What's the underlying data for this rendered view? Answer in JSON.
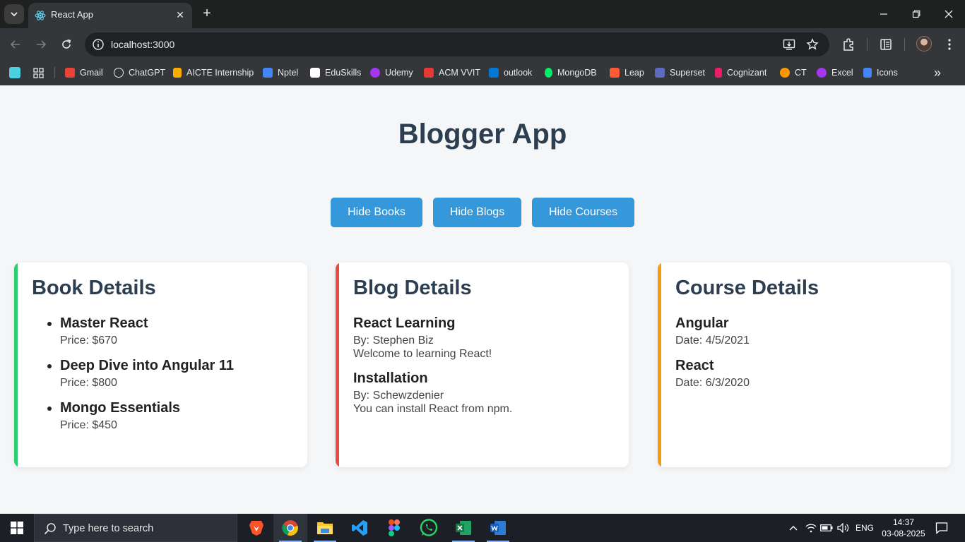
{
  "browser": {
    "tab": {
      "title": "React App",
      "close_glyph": "✕"
    },
    "new_tab_glyph": "+",
    "url": "localhost:3000",
    "bookmarks": [
      {
        "label": "Gmail",
        "icon": "gmail-icon",
        "color": "#ea4335"
      },
      {
        "label": "ChatGPT",
        "icon": "chatgpt-icon",
        "color": "#e8eaed"
      },
      {
        "label": "AICTE Internship",
        "icon": "aicte-icon",
        "color": "#f9ab00"
      },
      {
        "label": "Nptel",
        "icon": "nptel-icon",
        "color": "#4285f4"
      },
      {
        "label": "EduSkills",
        "icon": "eduskills-icon",
        "color": "#ffffff"
      },
      {
        "label": "Udemy",
        "icon": "udemy-icon",
        "color": "#a435f0"
      },
      {
        "label": "ACM VVIT",
        "icon": "acm-icon",
        "color": "#e53935"
      },
      {
        "label": "outlook",
        "icon": "outlook-icon",
        "color": "#0078d4"
      },
      {
        "label": "MongoDB",
        "icon": "mongodb-icon",
        "color": "#00ed64"
      },
      {
        "label": "Leap",
        "icon": "leap-icon",
        "color": "#ff5a36"
      },
      {
        "label": "Superset",
        "icon": "superset-icon",
        "color": "#5c6bc0"
      },
      {
        "label": "Cognizant",
        "icon": "cognizant-icon",
        "color": "#e91e63"
      },
      {
        "label": "CT",
        "icon": "ct-icon",
        "color": "#ff9800"
      },
      {
        "label": "Excel",
        "icon": "excel-icon",
        "color": "#a435f0"
      },
      {
        "label": "Icons",
        "icon": "icons-icon",
        "color": "#4285f4"
      }
    ],
    "more_glyph": "»"
  },
  "app": {
    "title": "Blogger App",
    "buttons": {
      "hide_books": "Hide Books",
      "hide_blogs": "Hide Blogs",
      "hide_courses": "Hide Courses"
    },
    "colors": {
      "primary": "#3498db",
      "books_accent": "#2ecc71",
      "blogs_accent": "#e74c3c",
      "courses_accent": "#f39c12",
      "heading": "#2c3e50"
    },
    "books": {
      "title": "Book Details",
      "items": [
        {
          "name": "Master React",
          "price": "Price: $670"
        },
        {
          "name": "Deep Dive into Angular 11",
          "price": "Price: $800"
        },
        {
          "name": "Mongo Essentials",
          "price": "Price: $450"
        }
      ]
    },
    "blogs": {
      "title": "Blog Details",
      "items": [
        {
          "title": "React Learning",
          "author": "By: Stephen Biz",
          "content": "Welcome to learning React!"
        },
        {
          "title": "Installation",
          "author": "By: Schewzdenier",
          "content": "You can install React from npm."
        }
      ]
    },
    "courses": {
      "title": "Course Details",
      "items": [
        {
          "name": "Angular",
          "date": "Date: 4/5/2021"
        },
        {
          "name": "React",
          "date": "Date: 6/3/2020"
        }
      ]
    }
  },
  "taskbar": {
    "search_placeholder": "Type here to search",
    "apps": [
      "brave-icon",
      "chrome-icon",
      "file-explorer-icon",
      "vscode-icon",
      "figma-icon",
      "whatsapp-icon",
      "excel-icon",
      "word-icon"
    ],
    "language": "ENG",
    "time": "14:37",
    "date": "03-08-2025"
  }
}
